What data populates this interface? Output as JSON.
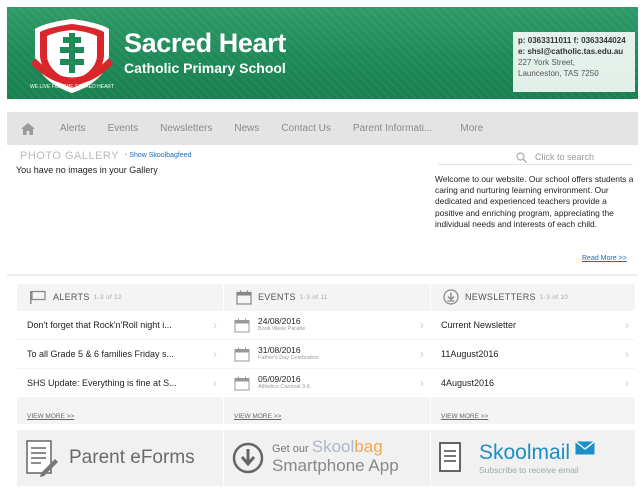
{
  "header": {
    "school_name": "Sacred Heart",
    "school_sub": "Catholic Primary School",
    "crest_motto": "WE LIVE FOR THE SACRED HEART",
    "contact": {
      "phone_line": "p: 0363311011 f: 0363344024",
      "email_line": "e: shsl@catholic.tas.edu.au",
      "street": "227 York Street,",
      "city": "Launceston, TAS 7250"
    }
  },
  "nav": {
    "home_icon": "home-icon",
    "items": [
      "Alerts",
      "Events",
      "Newsletters",
      "News",
      "Contact Us",
      "Parent Informati...",
      "More"
    ]
  },
  "gallery": {
    "title": "PHOTO GALLERY",
    "show_link": "- Show Skoolbagfeed",
    "empty_message": "You have no images in your Gallery"
  },
  "search": {
    "placeholder": "Click to search",
    "icon": "search-icon"
  },
  "welcome": {
    "text": "Welcome to our website. Our school offers students a caring and nurturing learning environment. Our dedicated and experienced teachers provide a positive and enriching program, appreciating the individual needs and interests of each child.",
    "read_more": "Read More >>"
  },
  "alerts": {
    "title": "ALERTS",
    "count": "1-3 of 12",
    "items": [
      "Don't forget that Rock'n'Roll night i...",
      "To all Grade 5 & 6 families Friday s...",
      "SHS Update: Everything is fine at S..."
    ],
    "view_more": "VIEW MORE >>"
  },
  "events": {
    "title": "EVENTS",
    "count": "1-3 of 11",
    "items": [
      {
        "date": "24/08/2016",
        "name": "Book Week Parade"
      },
      {
        "date": "31/08/2016",
        "name": "Father's Day Celebration"
      },
      {
        "date": "05/09/2016",
        "name": "Athletics Carnival 3-6"
      }
    ],
    "view_more": "VIEW MORE >>"
  },
  "newsletters": {
    "title": "NEWSLETTERS",
    "count": "1-3 of 10",
    "items": [
      "Current Newsletter",
      "11August2016",
      "4August2016"
    ],
    "view_more": "VIEW MORE >>"
  },
  "banners": {
    "eforms": "Parent eForms",
    "app_line1_prefix": "Get our",
    "app_skool": "Skool",
    "app_bag": "bag",
    "app_line2": "Smartphone App",
    "mail_skool": "Skool",
    "mail_mail": "mail",
    "mail_sub": "Subscribe to receive email"
  },
  "colors": {
    "header_green": "#1f8a58",
    "link_blue": "#1a6bb8",
    "panel_bg": "#f4f4f4",
    "skoolmail_blue": "#1d8fc8",
    "skoolbag_orange": "#f4a64a"
  }
}
